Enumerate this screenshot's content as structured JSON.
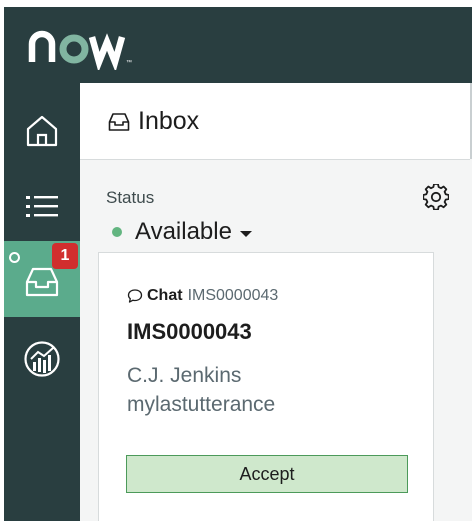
{
  "brand": {
    "logo_text": "now"
  },
  "colors": {
    "header_bg": "#293e40",
    "active_rail": "#5bab8c",
    "available": "#62b580",
    "badge": "#d12e2e",
    "accept_bg": "#cfe8cc",
    "accept_border": "#4c9a5a"
  },
  "rail": {
    "items": [
      {
        "name": "home",
        "icon": "home-icon"
      },
      {
        "name": "list",
        "icon": "list-icon"
      },
      {
        "name": "inbox",
        "icon": "inbox-tray-icon",
        "active": true,
        "badge": "1"
      },
      {
        "name": "reports",
        "icon": "chart-icon"
      }
    ]
  },
  "panel": {
    "title": "Inbox"
  },
  "status": {
    "label": "Status",
    "value": "Available"
  },
  "card": {
    "type": "Chat",
    "number_small": "IMS0000043",
    "number": "IMS0000043",
    "name": "C.J. Jenkins",
    "message": "mylastutterance",
    "accept_label": "Accept"
  }
}
